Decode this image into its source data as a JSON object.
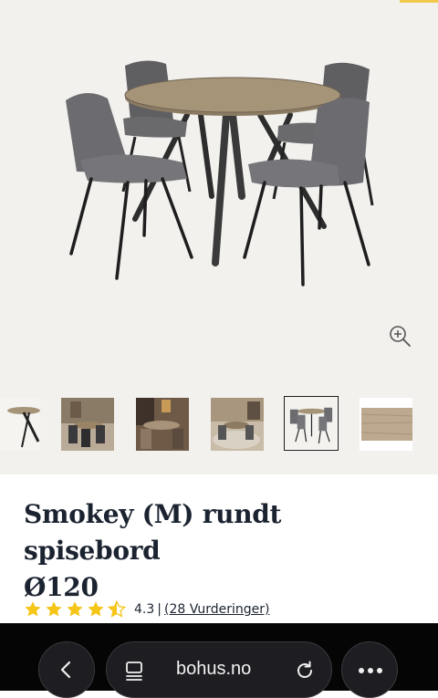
{
  "product": {
    "title_line1": "Smokey (M) rundt spisebord",
    "title_line2": "Ø120",
    "rating_value": "4.3",
    "rating_separator": "|",
    "rating_count_label": "(28 Vurderinger)",
    "rating_stars": 4.3,
    "star_color": "#f5c518"
  },
  "gallery": {
    "thumbnails": [
      "table-closeup",
      "dining-room-1",
      "dining-room-2",
      "dining-room-3",
      "table-set-selected",
      "wood-texture"
    ],
    "active_index": 4
  },
  "browser": {
    "url": "bohus.no",
    "icons": [
      "back-icon",
      "tabs-icon",
      "reload-icon",
      "more-icon"
    ]
  },
  "colors": {
    "hero_background": "#f2f1ee",
    "title_color": "#1b2330",
    "browser_bar": "#050505",
    "accent": "#f2c94c"
  }
}
